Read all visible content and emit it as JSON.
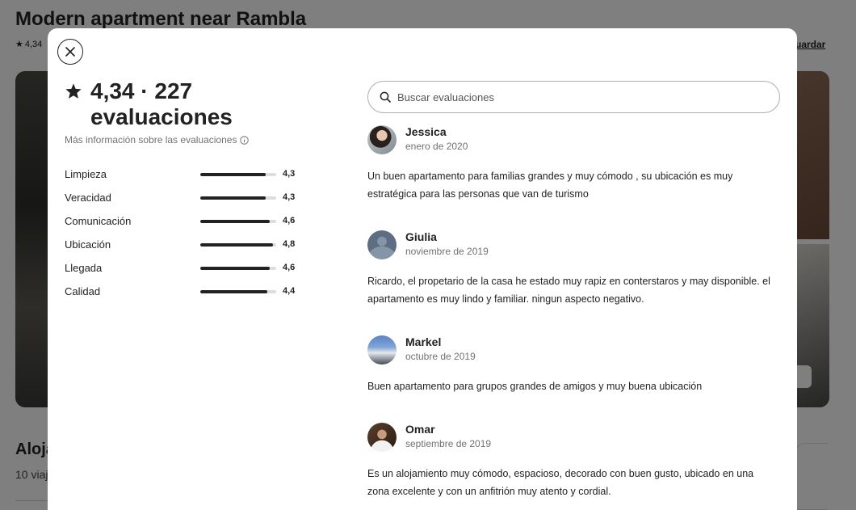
{
  "background": {
    "listing_title": "Modern apartment near Rambla",
    "rating_short": "4,34",
    "save_label": "uardar",
    "section_title": "Aloja",
    "section_subtitle": "10 viaj"
  },
  "modal": {
    "close_icon": "close-icon",
    "rating_value": "4,34 · 227",
    "reviews_word": "evaluaciones",
    "more_info": "Más información sobre las evaluaciones",
    "categories": [
      {
        "label": "Limpieza",
        "value": "4,3",
        "score": 4.3
      },
      {
        "label": "Veracidad",
        "value": "4,3",
        "score": 4.3
      },
      {
        "label": "Comunicación",
        "value": "4,6",
        "score": 4.6
      },
      {
        "label": "Ubicación",
        "value": "4,8",
        "score": 4.8
      },
      {
        "label": "Llegada",
        "value": "4,6",
        "score": 4.6
      },
      {
        "label": "Calidad",
        "value": "4,4",
        "score": 4.4
      }
    ],
    "search": {
      "placeholder": "Buscar evaluaciones"
    },
    "reviews": [
      {
        "name": "Jessica",
        "date": "enero de 2020",
        "text": "Un buen apartamento para familias grandes y muy cómodo , su ubicación es muy estratégica para las personas que van de turismo"
      },
      {
        "name": "Giulia",
        "date": "noviembre de 2019",
        "text": "Ricardo, el propetario de la casa he estado muy rapiz en conterstaros y may disponible. el apartamento es muy lindo y familiar. ningun aspecto negativo."
      },
      {
        "name": "Markel",
        "date": "octubre de 2019",
        "text": "Buen apartamento para grupos grandes de amigos y muy buena ubicación"
      },
      {
        "name": "Omar",
        "date": "septiembre de 2019",
        "text": "Es un alojamiento muy cómodo, espacioso, decorado con buen gusto, ubicado en una zona excelente y con un anfitrión muy atento y cordial."
      }
    ]
  }
}
